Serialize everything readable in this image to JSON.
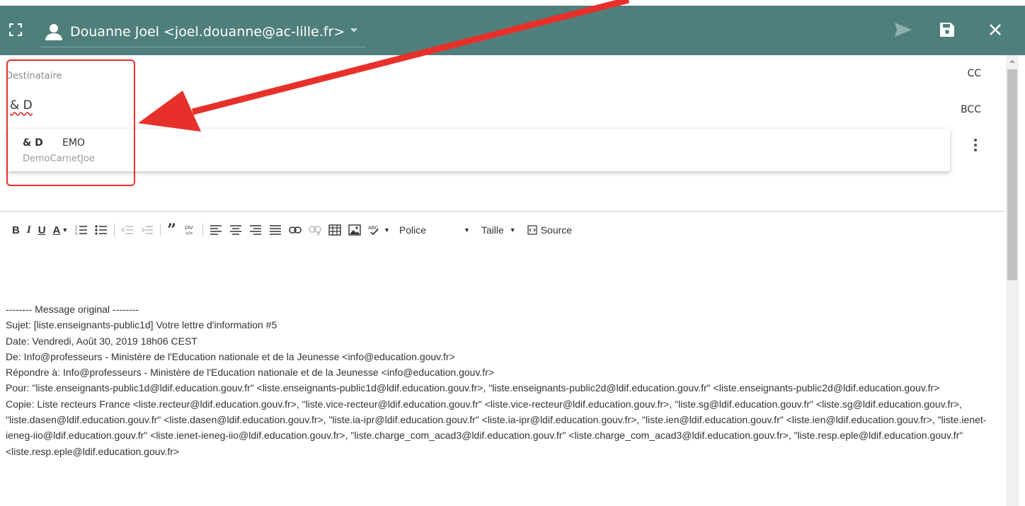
{
  "header": {
    "from": "Douanne Joel <joel.douanne@ac-lille.fr>",
    "icons": {
      "expand": "fullscreen-icon",
      "user": "person-icon",
      "send": "send-icon",
      "save": "save-icon",
      "close": "close-icon"
    },
    "color": "#4f7f7c"
  },
  "recipients": {
    "label": "Destinataire",
    "value": "& D",
    "cc_label": "CC",
    "bcc_label": "BCC"
  },
  "suggestion": {
    "name": "& D",
    "extra": "EMO",
    "addressbook": "DemoCarnetJoe"
  },
  "toolbar": {
    "bold": "B",
    "italic": "I",
    "underline": "U",
    "textcolor": "A",
    "font": "Police",
    "size": "Taille",
    "source": "Source"
  },
  "message": {
    "lines": [
      "-------- Message original --------",
      "Sujet: [liste.enseignants-public1d] Votre lettre d'information #5",
      "Date: Vendredi, Août 30, 2019 18h06 CEST",
      "De: Info@professeurs - Ministère de l'Education nationale et de la Jeunesse <info@education.gouv.fr>",
      "Répondre à: Info@professeurs - Ministère de l'Education nationale et de la Jeunesse <info@education.gouv.fr>",
      "Pour: \"liste.enseignants-public1d@ldif.education.gouv.fr\" <liste.enseignants-public1d@ldif.education.gouv.fr>, \"liste.enseignants-public2d@ldif.education.gouv.fr\" <liste.enseignants-public2d@ldif.education.gouv.fr>",
      "Copie: Liste recteurs France <liste.recteur@ldif.education.gouv.fr>, \"liste.vice-recteur@ldif.education.gouv.fr\" <liste.vice-recteur@ldif.education.gouv.fr>, \"liste.sg@ldif.education.gouv.fr\" <liste.sg@ldif.education.gouv.fr>, \"liste.dasen@ldif.education.gouv.fr\" <liste.dasen@ldif.education.gouv.fr>, \"liste.ia-ipr@ldif.education.gouv.fr\" <liste.ia-ipr@ldif.education.gouv.fr>, \"liste.ien@ldif.education.gouv.fr\" <liste.ien@ldif.education.gouv.fr>, \"liste.ienet-ieneg-iio@ldif.education.gouv.fr\" <liste.ienet-ieneg-iio@ldif.education.gouv.fr>, \"liste.charge_com_acad3@ldif.education.gouv.fr\" <liste.charge_com_acad3@ldif.education.gouv.fr>, \"liste.resp.eple@ldif.education.gouv.fr\" <liste.resp.eple@ldif.education.gouv.fr>"
    ]
  },
  "annotation_color": "#e8302a"
}
